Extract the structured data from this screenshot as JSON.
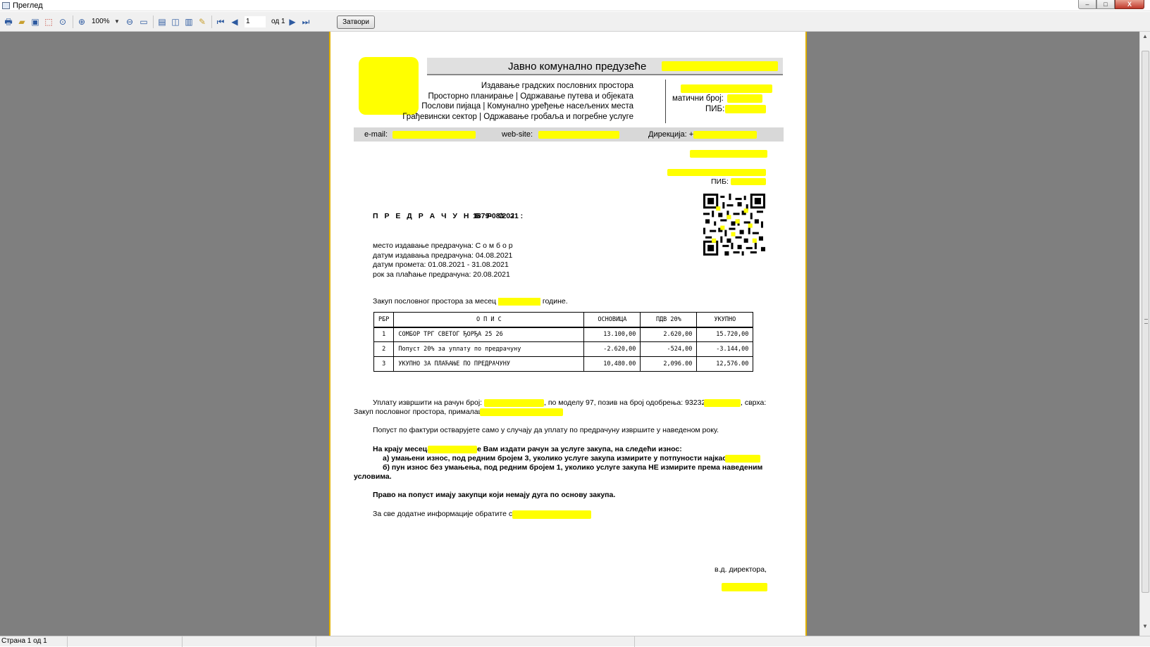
{
  "window": {
    "title": "Преглед",
    "minimize": "–",
    "maximize": "□",
    "close": "X"
  },
  "toolbar": {
    "zoom": "100%",
    "page_current": "1",
    "page_of": "од 1",
    "close_label": "Затвори"
  },
  "status": {
    "page_text": "Страна 1 од 1"
  },
  "document": {
    "company_title": "Јавно комунално предузеће",
    "services": [
      "Издавање градских пословних простора",
      "Просторно планирање | Одржавање путева и објеката",
      "Послови пијаца | Комунално уређење насељених места",
      "Грађевински сектор | Одржавање гробаља и погребне услуге"
    ],
    "reg_id_label": "матични број:",
    "tax_id_label": "ПИБ:",
    "email_label": "e-mail:",
    "website_label": "web-site:",
    "direction_label": "Дирекција: +",
    "recipient_tax_label": "ПИБ:",
    "title": "П Р Е Д Р А Ч У Н   Б Р О Ј :",
    "number": "1879-08/2021",
    "meta": [
      "место издавање предрачуна: С о м б о р",
      "датум издавања предрачуна: 04.08.2021",
      "датум промета: 01.08.2021 - 31.08.2021",
      "рок за плаћање предрачуна: 20.08.2021"
    ],
    "lease_prefix": "Закуп пословног простора за месец",
    "lease_suffix": "године.",
    "table": {
      "headers": [
        "РБР",
        "О   П   И   С",
        "ОСНОВИЦА",
        "ПДВ 20%",
        "УКУПНО"
      ],
      "rows": [
        [
          "1",
          "СОМБОР ТРГ СВЕТОГ ЂОРЂА 25    26",
          "13.100,00",
          "2.620,00",
          "15.720,00"
        ],
        [
          "2",
          "Попуст 20% за уплату по предрачуну",
          "-2.620,00",
          "-524,00",
          "-3.144,00"
        ],
        [
          "3",
          "УКУПНО ЗА ПЛАЋАЊЕ ПО ПРЕДРАЧУНУ",
          "10,480.00",
          "2,096.00",
          "12,576.00"
        ]
      ]
    },
    "payment_1": "Уплату извршити на рачун број:",
    "payment_2": ", по моделу 97, позив на број одобрења: 93232",
    "payment_3": ", сврха:",
    "payment_4": "Закуп пословног простора, прималац:",
    "discount_note": "Попуст по фактури остварујете само у случају да уплату по предрачуну извршите у наведеном року.",
    "end_month_a": "На крају месеца",
    "end_month_b": "е Вам издати рачун за услуге закупа, на следећи износ:",
    "option_a": "а)  умањени износ, под редним бројем 3, уколико услуге закупа измирите у потпуности најкасније до",
    "option_b": "б)  пун износ без умањења, под редним бројем 1,  уколико услуге закупа НЕ измирите према наведеним",
    "option_b2": "условима.",
    "right_note": "Право на попуст имају закупци који немају дуга по основу закупа.",
    "info_note": "За све додатне информације обратите се у",
    "signature": "в.д. директора,"
  },
  "colors": {
    "redaction": "#ffff00",
    "viewer_bg": "#7f7f7f",
    "page_border": "#e0b000"
  }
}
